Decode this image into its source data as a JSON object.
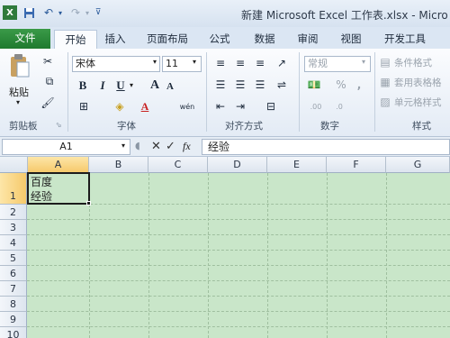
{
  "window": {
    "title": "新建 Microsoft Excel 工作表.xlsx - Micro"
  },
  "qat": {
    "save_icon": "save-icon",
    "undo_icon": "undo-icon",
    "redo_icon": "redo-icon"
  },
  "tabs": [
    "文件",
    "开始",
    "插入",
    "页面布局",
    "公式",
    "数据",
    "审阅",
    "视图",
    "开发工具"
  ],
  "ribbon": {
    "clipboard": {
      "label": "剪贴板",
      "paste": "粘贴"
    },
    "font": {
      "label": "字体",
      "name": "宋体",
      "size": "11",
      "bold": "B",
      "italic": "I",
      "underline": "U",
      "grow": "A",
      "shrink": "A",
      "underline_char": "A",
      "phonetic": "wén"
    },
    "alignment": {
      "label": "对齐方式"
    },
    "number": {
      "label": "数字",
      "format": "常规",
      "percent": "%",
      "comma": ","
    },
    "styles": {
      "label": "样式",
      "conditional": "条件格式",
      "table": "套用表格格",
      "cell": "单元格样式"
    }
  },
  "formula_bar": {
    "name_box": "A1",
    "fx": "fx",
    "content": "经验"
  },
  "grid": {
    "columns": [
      "A",
      "B",
      "C",
      "D",
      "E",
      "F",
      "G"
    ],
    "rows": [
      "1",
      "2",
      "3",
      "4",
      "5",
      "6",
      "7",
      "8",
      "9",
      "10"
    ],
    "cell_a1": "百度\n经验"
  },
  "colors": {
    "file_tab": "#2a8a3a",
    "grid_bg": "#c9e6c9",
    "ribbon_bg": "#fbfcfe"
  }
}
